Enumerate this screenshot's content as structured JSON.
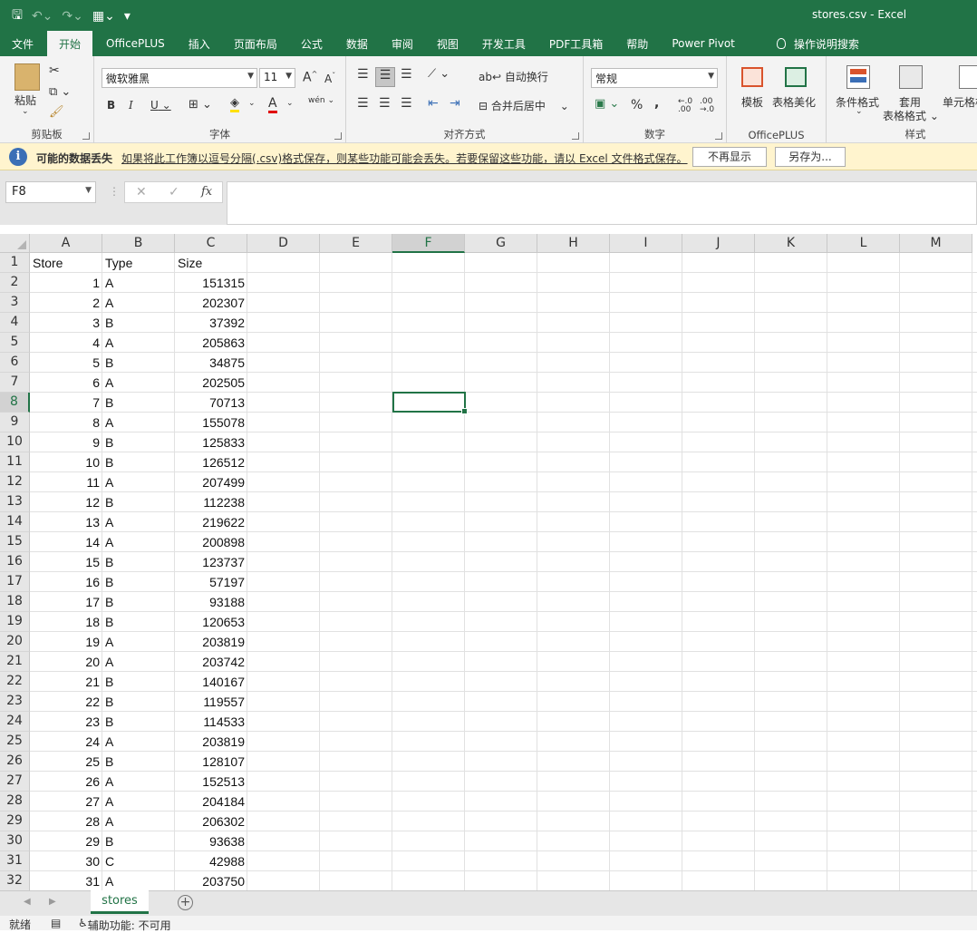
{
  "window": {
    "title": "stores.csv  -  Excel",
    "qat": [
      "save-icon",
      "undo-icon",
      "redo-icon",
      "table-icon",
      "customize-icon"
    ]
  },
  "tabs": [
    "文件",
    "开始",
    "OfficePLUS",
    "插入",
    "页面布局",
    "公式",
    "数据",
    "审阅",
    "视图",
    "开发工具",
    "PDF工具箱",
    "帮助",
    "Power Pivot",
    "操作说明搜索"
  ],
  "ribbon": {
    "clipboard": {
      "paste": "粘贴",
      "label": "剪贴板"
    },
    "font": {
      "name": "微软雅黑",
      "size": "11",
      "grow": "A",
      "shrink": "A",
      "bold": "B",
      "italic": "I",
      "underline": "U",
      "label": "字体",
      "wen": "wén"
    },
    "align": {
      "wrap": "自动换行",
      "merge": "合并后居中",
      "label": "对齐方式"
    },
    "number": {
      "format": "常规",
      "percent": "%",
      "comma": ",",
      "label": "数字"
    },
    "officeplus": {
      "template": "模板",
      "beautify": "表格美化",
      "label": "OfficePLUS"
    },
    "styles": {
      "cond": "条件格式",
      "table1": "套用",
      "table2": "表格格式",
      "cell": "单元格样式",
      "label": "样式"
    }
  },
  "message": {
    "title": "可能的数据丢失",
    "text": "如果将此工作簿以逗号分隔(.csv)格式保存，则某些功能可能会丢失。若要保留这些功能，请以 Excel 文件格式保存。",
    "dismiss": "不再显示",
    "saveas": "另存为..."
  },
  "formula": {
    "namebox": "F8",
    "cancel": "✕",
    "enter": "✓",
    "fx": "fx",
    "value": ""
  },
  "columns": [
    "A",
    "B",
    "C",
    "D",
    "E",
    "F",
    "G",
    "H",
    "I",
    "J",
    "K",
    "L",
    "M"
  ],
  "selected_col": "F",
  "selected_row": 8,
  "header_row": [
    "Store",
    "Type",
    "Size"
  ],
  "rows": [
    [
      1,
      "A",
      151315
    ],
    [
      2,
      "A",
      202307
    ],
    [
      3,
      "B",
      37392
    ],
    [
      4,
      "A",
      205863
    ],
    [
      5,
      "B",
      34875
    ],
    [
      6,
      "A",
      202505
    ],
    [
      7,
      "B",
      70713
    ],
    [
      8,
      "A",
      155078
    ],
    [
      9,
      "B",
      125833
    ],
    [
      10,
      "B",
      126512
    ],
    [
      11,
      "A",
      207499
    ],
    [
      12,
      "B",
      112238
    ],
    [
      13,
      "A",
      219622
    ],
    [
      14,
      "A",
      200898
    ],
    [
      15,
      "B",
      123737
    ],
    [
      16,
      "B",
      57197
    ],
    [
      17,
      "B",
      93188
    ],
    [
      18,
      "B",
      120653
    ],
    [
      19,
      "A",
      203819
    ],
    [
      20,
      "A",
      203742
    ],
    [
      21,
      "B",
      140167
    ],
    [
      22,
      "B",
      119557
    ],
    [
      23,
      "B",
      114533
    ],
    [
      24,
      "A",
      203819
    ],
    [
      25,
      "B",
      128107
    ],
    [
      26,
      "A",
      152513
    ],
    [
      27,
      "A",
      204184
    ],
    [
      28,
      "A",
      206302
    ],
    [
      29,
      "B",
      93638
    ],
    [
      30,
      "C",
      42988
    ],
    [
      31,
      "A",
      203750
    ]
  ],
  "sheet": {
    "name": "stores",
    "add": "+"
  },
  "status": {
    "ready": "就绪",
    "accessibility": "辅助功能: 不可用"
  },
  "colors": {
    "accent": "#217346",
    "message_bg": "#fff4ce",
    "ribbon_bg": "#f3f3f3"
  }
}
